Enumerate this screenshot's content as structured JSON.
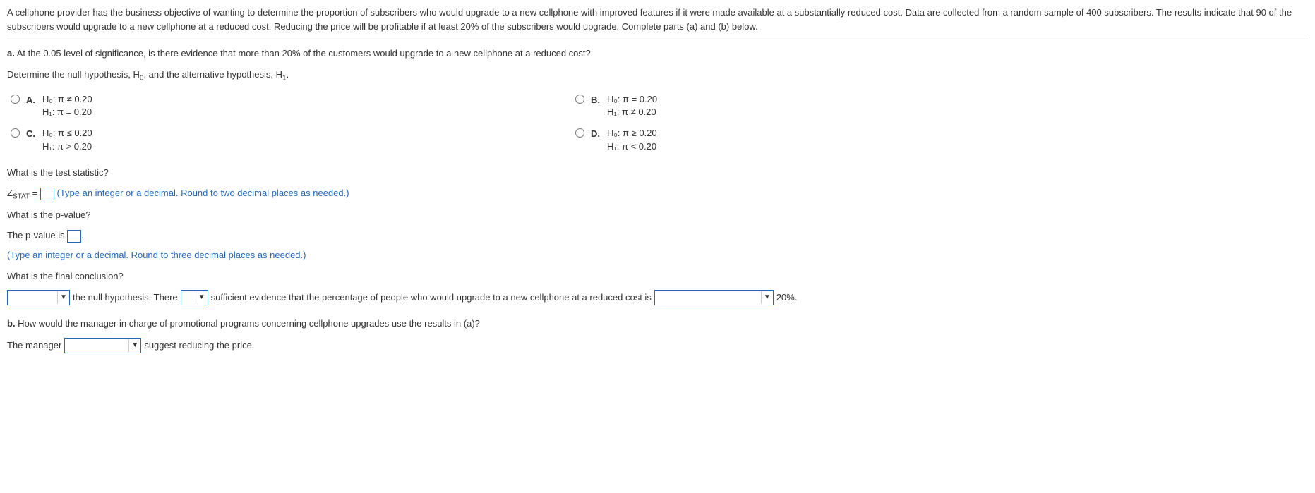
{
  "intro": "A cellphone provider has the business objective of wanting to determine the proportion of subscribers who would upgrade to a new cellphone with improved features if it were made available at a substantially reduced cost. Data are collected from a random sample of 400 subscribers. The results indicate that 90 of the subscribers would upgrade to a new cellphone at a reduced cost. Reducing the price will be profitable if at least 20% of the subscribers would upgrade. Complete parts (a) and (b) below.",
  "partA": {
    "prompt_bold": "a.",
    "prompt_text": " At the 0.05 level of significance, is there evidence that more than 20% of the customers would upgrade to a new cellphone at a reduced cost?",
    "hypothesis_prompt_pre": "Determine the null hypothesis, H",
    "hypothesis_prompt_mid": ", and the alternative hypothesis, H",
    "hypothesis_prompt_end": ".",
    "choices": {
      "A": {
        "label": "A.",
        "h0": "H₀: π ≠ 0.20",
        "h1": "H₁: π = 0.20"
      },
      "B": {
        "label": "B.",
        "h0": "H₀: π = 0.20",
        "h1": "H₁: π ≠ 0.20"
      },
      "C": {
        "label": "C.",
        "h0": "H₀: π ≤ 0.20",
        "h1": "H₁: π > 0.20"
      },
      "D": {
        "label": "D.",
        "h0": "H₀: π ≥ 0.20",
        "h1": "H₁: π < 0.20"
      }
    },
    "test_stat_q": "What is the test statistic?",
    "zstat_pre": "Z",
    "zstat_sub": "STAT",
    "zstat_eq": " = ",
    "zstat_hint": "(Type an integer or a decimal. Round to two decimal places as needed.)",
    "pvalue_q": "What is the p-value?",
    "pvalue_pre": "The p-value is ",
    "pvalue_post": ".",
    "pvalue_hint": "(Type an integer or a decimal. Round to three decimal places as needed.)",
    "conclusion_q": "What is the final conclusion?",
    "conclusion": {
      "t1": " the null hypothesis. There ",
      "t2": " sufficient evidence that the percentage of people who would upgrade to a new cellphone at a reduced cost is ",
      "t3": " 20%."
    }
  },
  "partB": {
    "prompt_bold": "b.",
    "prompt_text": " How would the manager in charge of promotional programs concerning cellphone upgrades use the results in (a)?",
    "line_pre": "The manager ",
    "line_post": " suggest reducing the price."
  }
}
